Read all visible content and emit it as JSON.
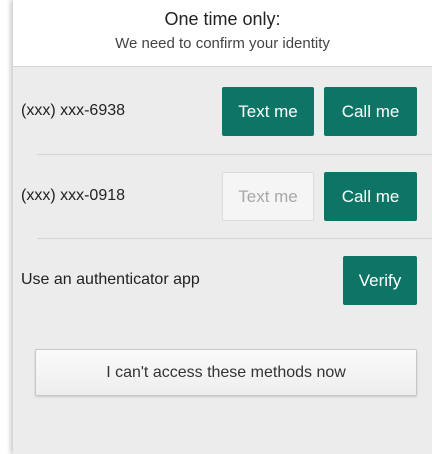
{
  "header": {
    "title": "One time only:",
    "subtitle": "We need to confirm your identity"
  },
  "methods": [
    {
      "phone": "(xxx) xxx-6938",
      "text_label": "Text me",
      "text_enabled": true,
      "call_label": "Call me"
    },
    {
      "phone": "(xxx) xxx-0918",
      "text_label": "Text me",
      "text_enabled": false,
      "call_label": "Call me"
    }
  ],
  "authenticator": {
    "label": "Use an authenticator app",
    "verify_label": "Verify"
  },
  "fallback": {
    "label": "I can't access these methods now"
  },
  "colors": {
    "accent": "#0e7566",
    "panel_background": "#ececec",
    "disabled_text": "#a8a8a8"
  }
}
